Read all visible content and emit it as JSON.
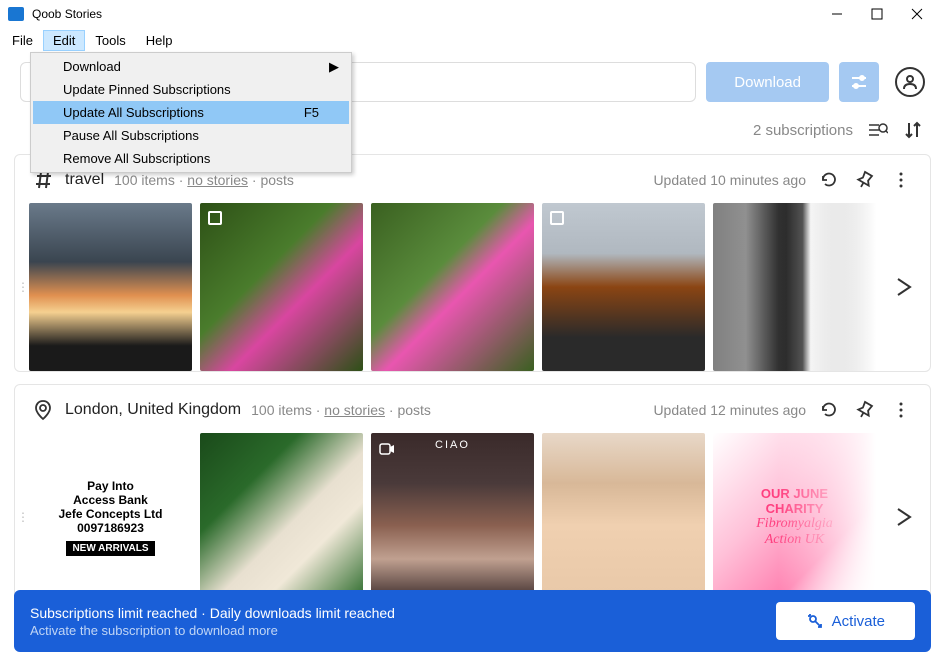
{
  "app": {
    "title": "Qoob Stories"
  },
  "menubar": [
    "File",
    "Edit",
    "Tools",
    "Help"
  ],
  "edit_menu": {
    "download": "Download",
    "update_pinned": "Update Pinned Subscriptions",
    "update_all": {
      "label": "Update All Subscriptions",
      "shortcut": "F5"
    },
    "pause_all": "Pause All Subscriptions",
    "remove_all": "Remove All Subscriptions"
  },
  "toolbar": {
    "download_label": "Download",
    "search_placeholder": ""
  },
  "subs": {
    "count_text": "2 subscriptions"
  },
  "cards": [
    {
      "icon": "hashtag",
      "title": "travel",
      "items": "100 items",
      "stories": "no stories",
      "posts": "posts",
      "updated": "Updated 10 minutes ago"
    },
    {
      "icon": "location",
      "title": "London, United Kingdom",
      "items": "100 items",
      "stories": "no stories",
      "posts": "posts",
      "updated": "Updated 12 minutes ago"
    }
  ],
  "thumb_text": {
    "pay_into": "Pay Into",
    "bank": "Access Bank",
    "company": "Jefe Concepts Ltd",
    "number": "0097186923",
    "arrivals": "NEW ARRIVALS",
    "our_june": "OUR JUNE",
    "charity": "CHARITY",
    "fibro": "Fibromyalgia",
    "action": "Action UK"
  },
  "banner": {
    "line1": "Subscriptions limit reached · Daily downloads limit reached",
    "line2": "Activate the subscription to download more",
    "button": "Activate"
  }
}
